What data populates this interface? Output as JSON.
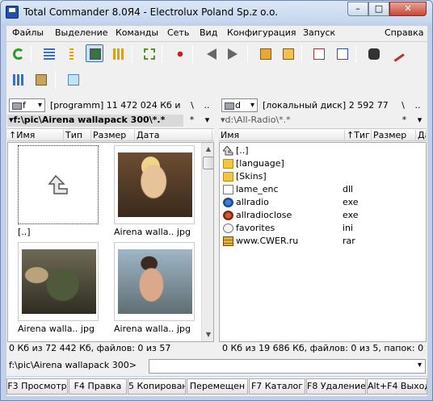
{
  "window": {
    "title": "Total Commander 8.0Я4 - Electrolux Poland Sp.z o.o."
  },
  "caption": {
    "min": "–",
    "max": "□",
    "close": "✕"
  },
  "menu": [
    "Файлы",
    "Выделение",
    "Команды",
    "Сеть",
    "Вид",
    "Конфигурация",
    "Запуск",
    "Справка"
  ],
  "left": {
    "drive": "f",
    "drive_info": "[programm]  11 472 024 Кб и",
    "root_btn": "\\",
    "up_btn": "..",
    "path": "▾f:\\pic\\Airena wallapack 300\\*.*",
    "path_star": "*",
    "path_menu": "▾",
    "columns": [
      "↑Имя",
      "Тип",
      "Размер",
      "Дата"
    ],
    "thumbs": [
      {
        "label": "[..]"
      },
      {
        "label": "Airena walla.. jpg"
      },
      {
        "label": "Airena walla.. jpg"
      },
      {
        "label": "Airena walla.. jpg"
      }
    ],
    "scroll_up": "▲",
    "scroll_down": "▼",
    "status": "0 Кб из 72 442 Кб, файлов: 0 из 57"
  },
  "right": {
    "drive": "d",
    "drive_info": "[локальный диск]  2 592 77",
    "root_btn": "\\",
    "up_btn": "..",
    "path": "▾d:\\All-Radio\\*.*",
    "path_star": "*",
    "path_menu": "▾",
    "columns": [
      "Имя",
      "↑Тиг",
      "Размер",
      "Да"
    ],
    "files": [
      {
        "name": "[..]",
        "ext": "",
        "icon": "up-arrow-icon"
      },
      {
        "name": "[language]",
        "ext": "",
        "icon": "folder-icon"
      },
      {
        "name": "[Skins]",
        "ext": "",
        "icon": "folder-icon"
      },
      {
        "name": "lame_enc",
        "ext": "dll",
        "icon": "dll-file-icon"
      },
      {
        "name": "allradio",
        "ext": "exe",
        "icon": "app-icon"
      },
      {
        "name": "allradioclose",
        "ext": "exe",
        "icon": "app-icon"
      },
      {
        "name": "favorites",
        "ext": "ini",
        "icon": "settings-file-icon"
      },
      {
        "name": "www.CWER.ru",
        "ext": "rar",
        "icon": "archive-icon"
      }
    ],
    "status": "0 Кб из 19 686 Кб, файлов: 0 из 5, папок: 0"
  },
  "cmdline": {
    "path": "f:\\pic\\Airena wallapack 300>"
  },
  "fkeys": [
    "F3 Просмотр",
    "F4 Правка",
    "5 Копирован",
    "Перемещен",
    "F7 Каталог",
    "F8 Удаление",
    "Alt+F4 Выход"
  ],
  "colors": {
    "accent": "#3a6fb7",
    "active_path_bg": "#d9d9d9",
    "window_frame": "#bfd1ea"
  }
}
